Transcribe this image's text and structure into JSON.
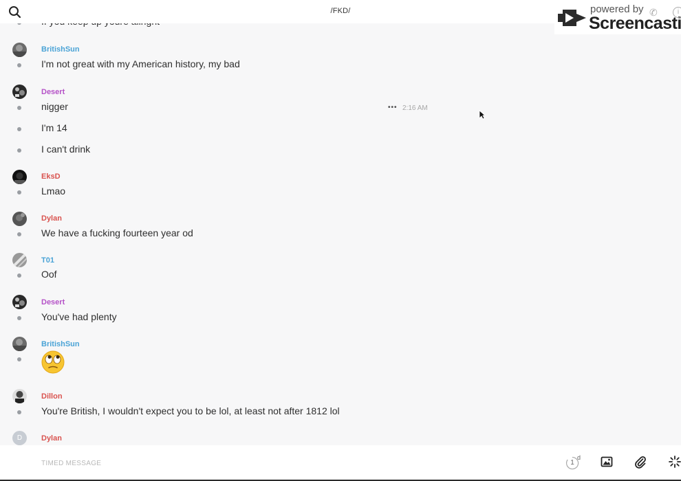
{
  "header": {
    "title": "/FKD/",
    "search_icon": "search-icon"
  },
  "watermark": {
    "powered_by": "powered by",
    "brand": "Screencastify"
  },
  "messages": [
    {
      "lines": [
        {
          "text": "If you keep up youre allright"
        }
      ]
    },
    {
      "user": "BritishSun",
      "color": "#4aa3d6",
      "avatar": "photo-grey",
      "lines": [
        {
          "text": "I'm not great with my American history, my bad"
        }
      ]
    },
    {
      "user": "Desert",
      "color": "#b552c7",
      "avatar": "photo-dark",
      "lines": [
        {
          "text": "nigger",
          "time": "2:16 AM",
          "more": "•••"
        },
        {
          "text": "I'm 14"
        },
        {
          "text": "I can't drink"
        }
      ]
    },
    {
      "user": "EksD",
      "color": "#d9534f",
      "avatar": "photo-black",
      "lines": [
        {
          "text": "Lmao"
        }
      ]
    },
    {
      "user": "Dylan",
      "color": "#d9534f",
      "avatar": "photo-grey",
      "lines": [
        {
          "text": "We have a fucking fourteen year od"
        }
      ]
    },
    {
      "user": "T01",
      "color": "#4aa3d6",
      "avatar": "photo-light",
      "lines": [
        {
          "text": "Oof"
        }
      ]
    },
    {
      "user": "Desert",
      "color": "#b552c7",
      "avatar": "photo-dark",
      "lines": [
        {
          "text": "You've had plenty"
        }
      ]
    },
    {
      "user": "BritishSun",
      "color": "#4aa3d6",
      "avatar": "photo-grey",
      "lines": [
        {
          "emoji": "face-with-rolling-eyes"
        }
      ]
    },
    {
      "user": "Dillon",
      "color": "#d9534f",
      "avatar": "photo-bw",
      "lines": [
        {
          "text": "You're British, I wouldn't expect you to be lol, at least not after 1812 lol"
        }
      ]
    },
    {
      "user": "Dylan",
      "color": "#d9534f",
      "avatar": "letter",
      "avatar_letter": "D",
      "lines": []
    }
  ],
  "composer": {
    "placeholder": "TIMED MESSAGE",
    "timer_value": "1",
    "timer_unit": "d",
    "tools": [
      "image-icon",
      "paperclip-icon",
      "sparkle-icon"
    ]
  }
}
